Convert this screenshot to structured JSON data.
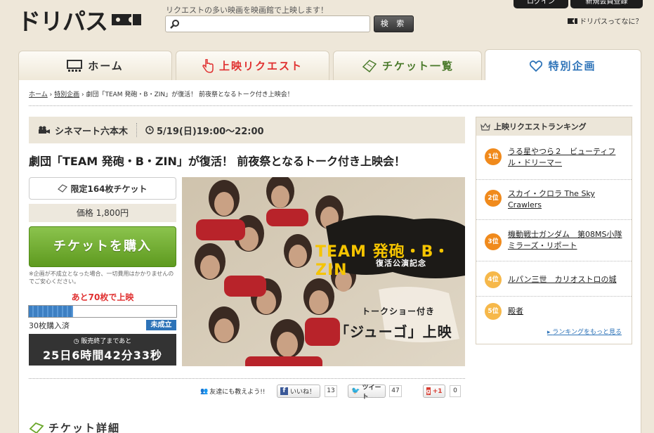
{
  "header": {
    "logo_text": "ドリパス",
    "tagline": "リクエストの多い映画を映画館で上映します！",
    "search_placeholder": "",
    "search_button": "検 索",
    "login": "ログイン",
    "register": "新規会員登録",
    "about_link": "ドリパスってなに？"
  },
  "tabs": [
    {
      "label": "ホーム"
    },
    {
      "label": "上映リクエスト"
    },
    {
      "label": "チケット一覧"
    },
    {
      "label": "特別企画"
    }
  ],
  "breadcrumb": {
    "home": "ホーム",
    "separator": "›",
    "special": "特別企画",
    "current": "劇団「TEAM 発砲・B・ZIN」が復活！ 前夜祭となるトーク付き上映会！"
  },
  "event": {
    "venue": "シネマート六本木",
    "datetime": "5/19(日)19:00～22:00",
    "title": "劇団「TEAM 発砲・B・ZIN」が復活！ 前夜祭となるトーク付き上映会！"
  },
  "ticket": {
    "limited": "限定164枚チケット",
    "price": "価格 1,800円",
    "buy_button": "チケットを購入",
    "note": "※企画が不成立となった場合、一切費用はかかりませんのでご安心ください。",
    "remaining": "あと70枚で上映",
    "progress": 0.3,
    "purchased": "30枚購入済",
    "status": "未成立",
    "countdown_label": "販売終了まであと",
    "countdown": "25日6時間42分33秒"
  },
  "poster": {
    "logo": "TEAM 発砲・B・ZIN",
    "subtitle": "復活公演記念",
    "talk": "トークショー付き",
    "film": "「ジューゴ」上映"
  },
  "social": {
    "share_text": "友達にも教えよう!!",
    "like": "いいね！",
    "like_count": "13",
    "tweet": "ツイート",
    "tweet_count": "47",
    "gplus": "+1",
    "gplus_count": "0"
  },
  "detail_heading": "チケット詳細",
  "ranking": {
    "title": "上映リクエストランキング",
    "items": [
      {
        "rank": "1位",
        "title": "うる星やつら２　ビューティフル・ドリーマー"
      },
      {
        "rank": "2位",
        "title": "スカイ・クロラ The Sky Crawlers"
      },
      {
        "rank": "3位",
        "title": "機動戦士ガンダム　第08MS小隊 ミラーズ・リポート"
      },
      {
        "rank": "4位",
        "title": "ルパン三世　カリオストロの城"
      },
      {
        "rank": "5位",
        "title": "殿者"
      }
    ],
    "more": "ランキングをもっと見る"
  },
  "colors": {
    "background": "#eee7d9",
    "accent_red": "#e03030",
    "accent_blue": "#2d73b8",
    "accent_green": "#6aa72a",
    "rank_1_3": "#f08a1c",
    "rank_4_5": "#f6b84a"
  },
  "icons": {
    "search": "search-icon",
    "home": "theater-icon",
    "request": "hand-pointer-icon",
    "tickets": "ticket-icon",
    "special": "heart-icon",
    "venue": "video-camera-icon",
    "clock": "clock-icon",
    "crown": "crown-icon",
    "share": "people-icon",
    "detail": "ticket-icon"
  }
}
